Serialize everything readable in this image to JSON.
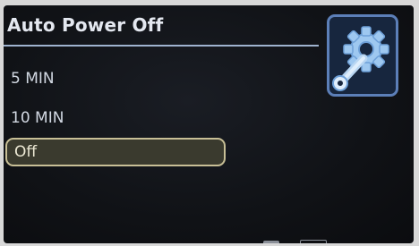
{
  "screen": {
    "title": "Auto Power Off",
    "icon": "settings-gear-wrench-icon",
    "colors": {
      "accent": "#5c7fb8",
      "selection_border": "#c8bf96",
      "text": "#d2d8e2",
      "background": "#101216"
    }
  },
  "menu": {
    "items": [
      {
        "label": "5 MIN"
      },
      {
        "label": "10 MIN"
      },
      {
        "label": "Off"
      }
    ],
    "selected": "Off"
  }
}
